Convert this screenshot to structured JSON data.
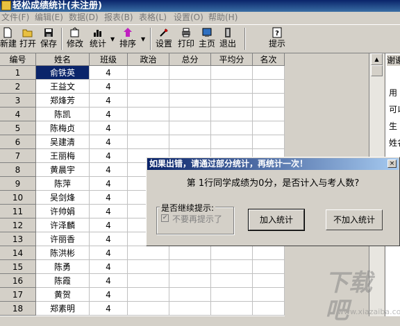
{
  "window": {
    "title": "轻松成绩统计(未注册)"
  },
  "menu": [
    "文件(F)",
    "编辑(E)",
    "数据(D)",
    "报表(B)",
    "表格(L)",
    "设置(O)",
    "帮助(H)"
  ],
  "toolbar": {
    "new": "新建",
    "open": "打开",
    "save": "保存",
    "edit": "修改",
    "stats": "统计",
    "sort": "排序",
    "settings": "设置",
    "print": "打印",
    "home": "主页",
    "exit": "退出",
    "hint": "提示"
  },
  "grid": {
    "headers": [
      "编号",
      "姓名",
      "班级",
      "政治",
      "总分",
      "平均分",
      "名次"
    ],
    "rows": [
      {
        "no": "1",
        "name": "俞铁英",
        "cls": "4"
      },
      {
        "no": "2",
        "name": "王益文",
        "cls": "4"
      },
      {
        "no": "3",
        "name": "郑烽芳",
        "cls": "4"
      },
      {
        "no": "4",
        "name": "陈凯",
        "cls": "4"
      },
      {
        "no": "5",
        "name": "陈梅贞",
        "cls": "4"
      },
      {
        "no": "6",
        "name": "吴建清",
        "cls": "4"
      },
      {
        "no": "7",
        "name": "王丽梅",
        "cls": "4"
      },
      {
        "no": "8",
        "name": "黄晨宇",
        "cls": "4"
      },
      {
        "no": "9",
        "name": "陈萍",
        "cls": "4"
      },
      {
        "no": "10",
        "name": "吴剑烽",
        "cls": "4"
      },
      {
        "no": "11",
        "name": "许帅娟",
        "cls": "4"
      },
      {
        "no": "12",
        "name": "许泽麟",
        "cls": "4"
      },
      {
        "no": "13",
        "name": "许丽香",
        "cls": "4"
      },
      {
        "no": "14",
        "name": "陈洪彬",
        "cls": "4"
      },
      {
        "no": "15",
        "name": "陈勇",
        "cls": "4"
      },
      {
        "no": "16",
        "name": "陈霞",
        "cls": "4"
      },
      {
        "no": "17",
        "name": "黄贺",
        "cls": "4"
      },
      {
        "no": "18",
        "name": "郑素明",
        "cls": "4"
      }
    ]
  },
  "help_panel": {
    "title": "谢谢",
    "lines": [
      "用",
      "可以",
      "生",
      "姓名"
    ]
  },
  "dialog": {
    "title": "如果出错，请通过部分统计，再统计一次！",
    "close": "×",
    "message": "第 1行同学成绩为0分，是否计入与考人数?",
    "group_label": "是否继续提示:",
    "checkbox_label": "不要再提示了",
    "checkbox_checked": true,
    "btn_include": "加入统计",
    "btn_exclude": "不加入统计"
  }
}
